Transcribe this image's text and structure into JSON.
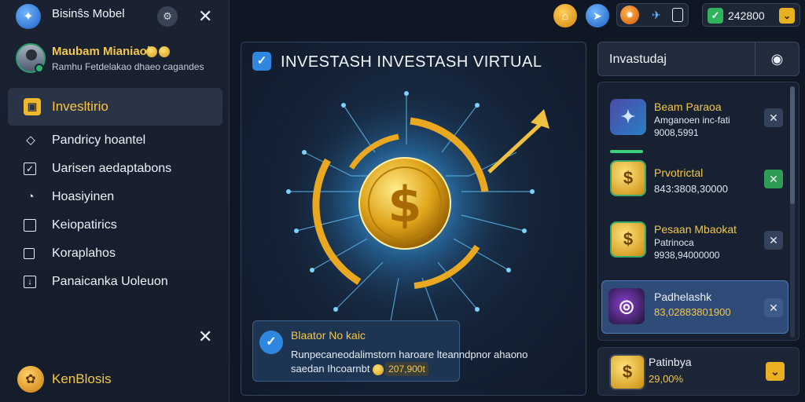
{
  "sidebar": {
    "brand_title": "Bisinŝs Mobel",
    "profile": {
      "name": "Maubam Mianiaoi",
      "coins": "",
      "subtitle": "Ramhu Fetdelakao dhaeo cagandes"
    },
    "nav_items": [
      {
        "label": "Invesltirio",
        "icon": "briefcase-icon",
        "active": true
      },
      {
        "label": "Pandricy hoantel",
        "icon": "diamond-icon"
      },
      {
        "label": "Uarisen aedaptabons",
        "icon": "checkbox-icon"
      },
      {
        "label": "Hoasiyinen",
        "icon": "clock-icon"
      },
      {
        "label": "Keiopatirics",
        "icon": "square-icon"
      },
      {
        "label": "Koraplahos",
        "icon": "square-icon"
      },
      {
        "label": "Panaicanka Uoleuon",
        "icon": "download-icon"
      }
    ],
    "footer_label": "KenBlosis"
  },
  "topbar": {
    "balance": "242800"
  },
  "main": {
    "title": "INVESTASH INVESTASH VIRTUAL",
    "info": {
      "title": "Blaator No kaic",
      "text": "Runpecaneodalimstorn haroare lteanndpnor ahaono saedan Ihcoarnbt",
      "amount": "207,900t"
    }
  },
  "right_panel": {
    "search_label": "Invastudaj",
    "items": [
      {
        "name": "Beam Paraoa",
        "sub": "Amganoen inc-fati",
        "value": "9008,5991",
        "icon": "bird-icon",
        "action": "✕",
        "style": "purple"
      },
      {
        "name": "Prvotrictal",
        "sub": "",
        "value": "843:3808,30000",
        "icon": "dollar-coin-icon",
        "action": "✕",
        "style": "gold",
        "green": true
      },
      {
        "name": "Pesaan Mbaokat",
        "sub": "Patrinoca",
        "value": "9938,94000000",
        "icon": "dollar-coin-icon",
        "action": "✕",
        "style": "gold"
      },
      {
        "name": "Padhelashk",
        "sub": "",
        "value": "83,02883801900",
        "icon": "vortex-icon",
        "action": "✕",
        "style": "dark",
        "selected": true
      }
    ],
    "bottom_card": {
      "name": "Patinbya",
      "value": "29,00%",
      "icon": "dollar-coin-icon"
    }
  },
  "colors": {
    "accent_gold": "#f4c64a",
    "accent_blue": "#2f87e0",
    "accent_green": "#30b35b",
    "background": "#0f1724"
  }
}
